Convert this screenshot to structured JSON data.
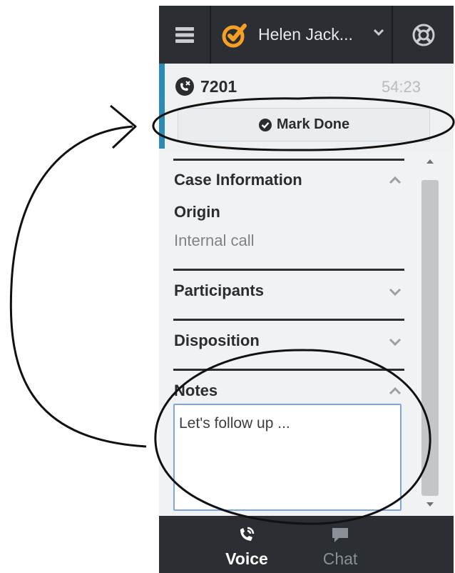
{
  "topbar": {
    "menu_icon": "hamburger-menu-icon",
    "status_icon": "agent-status-ready-icon",
    "user_name": "Helen Jack...",
    "dropdown_icon": "chevron-down-icon",
    "help_icon": "lifebuoy-help-icon"
  },
  "interaction": {
    "call_icon": "call-ended-icon",
    "number": "7201",
    "timer": "54:23",
    "mark_done_icon": "check-circle-icon",
    "mark_done_label": "Mark Done",
    "accent_color": "#2c8bb6"
  },
  "sections": {
    "case_information": {
      "title": "Case Information",
      "expanded": true
    },
    "origin": {
      "label": "Origin",
      "value": "Internal call"
    },
    "participants": {
      "title": "Participants",
      "expanded": false
    },
    "disposition": {
      "title": "Disposition",
      "expanded": false
    },
    "notes": {
      "title": "Notes",
      "expanded": true,
      "value": "Let's follow up ..."
    }
  },
  "bottombar": {
    "voice": {
      "label": "Voice",
      "icon": "phone-call-icon",
      "active": true
    },
    "chat": {
      "label": "Chat",
      "icon": "chat-bubble-icon",
      "active": false
    }
  },
  "colors": {
    "dark_bar": "#2b2e32",
    "status_orange": "#f5a024",
    "notes_border": "#7ea6e0"
  }
}
